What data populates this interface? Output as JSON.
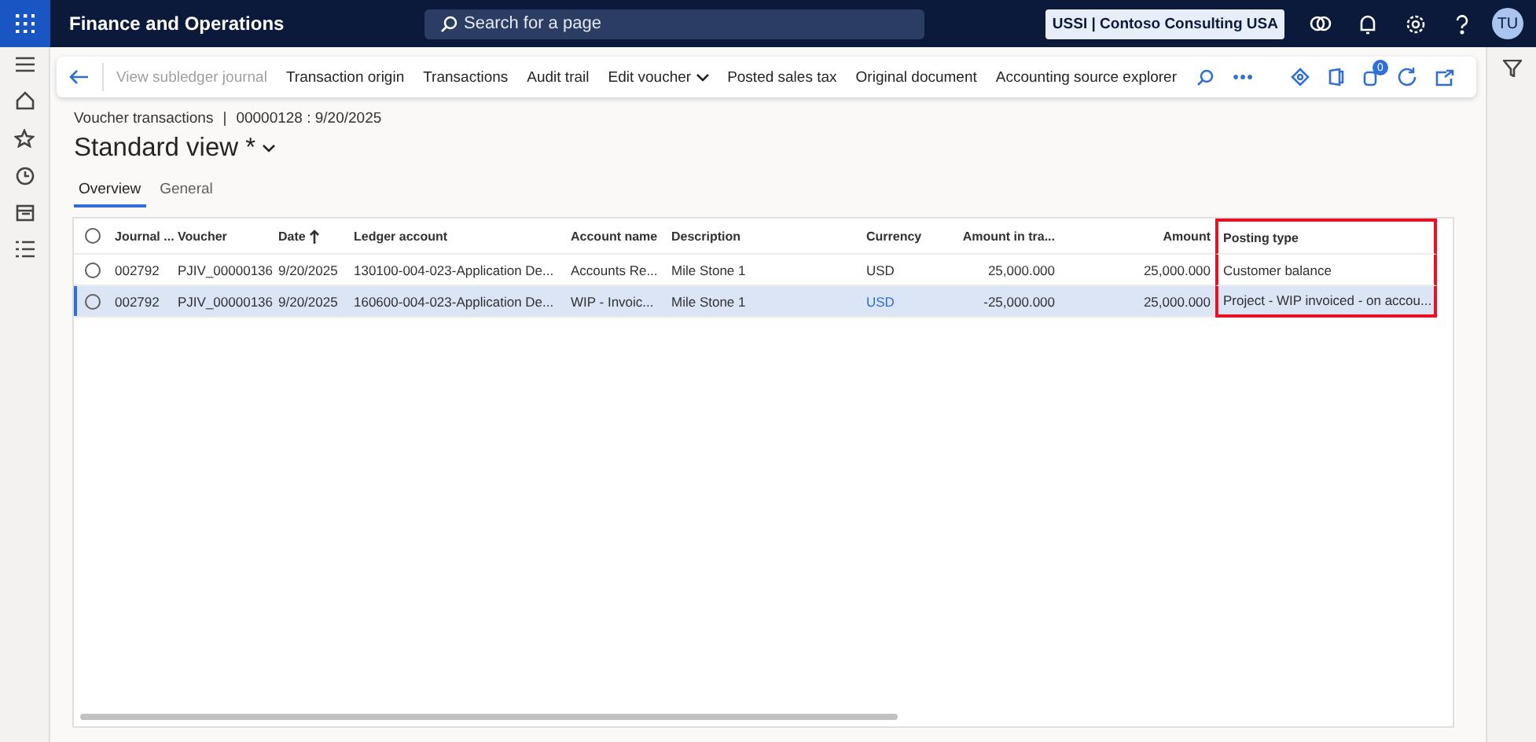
{
  "app_bar": {
    "title": "Finance and Operations",
    "search": {
      "placeholder": "Search for a page"
    },
    "company": "USSI | Contoso Consulting USA",
    "avatar": "TU"
  },
  "action_pane": {
    "items": [
      {
        "label": "View subledger journal",
        "disabled": true,
        "dropdown": false
      },
      {
        "label": "Transaction origin",
        "disabled": false,
        "dropdown": false
      },
      {
        "label": "Transactions",
        "disabled": false,
        "dropdown": false
      },
      {
        "label": "Audit trail",
        "disabled": false,
        "dropdown": false
      },
      {
        "label": "Edit voucher",
        "disabled": false,
        "dropdown": true
      },
      {
        "label": "Posted sales tax",
        "disabled": false,
        "dropdown": false
      },
      {
        "label": "Original document",
        "disabled": false,
        "dropdown": false
      },
      {
        "label": "Accounting source explorer",
        "disabled": false,
        "dropdown": false
      }
    ],
    "attachments_count": "0"
  },
  "breadcrumb": {
    "page": "Voucher transactions",
    "separator": "|",
    "record": "00000128 : 9/20/2025"
  },
  "view_title": "Standard view *",
  "tabs": [
    {
      "label": "Overview",
      "selected": true
    },
    {
      "label": "General",
      "selected": false
    }
  ],
  "grid": {
    "columns": [
      {
        "label": "Journal ...",
        "sorted": false,
        "highlighted": false
      },
      {
        "label": "Voucher",
        "sorted": false,
        "highlighted": false
      },
      {
        "label": "Date",
        "sorted": true,
        "highlighted": false
      },
      {
        "label": "Ledger account",
        "sorted": false,
        "highlighted": false
      },
      {
        "label": "Account name",
        "sorted": false,
        "highlighted": false
      },
      {
        "label": "Description",
        "sorted": false,
        "highlighted": false
      },
      {
        "label": "Currency",
        "sorted": false,
        "highlighted": false
      },
      {
        "label": "Amount in tra...",
        "sorted": false,
        "highlighted": false
      },
      {
        "label": "Amount",
        "sorted": false,
        "highlighted": false
      },
      {
        "label": "Posting type",
        "sorted": false,
        "highlighted": true
      }
    ],
    "all_selected": false,
    "rows": [
      {
        "selected": false,
        "cells": [
          "002792",
          "PJIV_00000136",
          "9/20/2025",
          "130100-004-023-Application De...",
          "Accounts Re...",
          "Mile Stone 1",
          "USD",
          "25,000.000",
          "25,000.000",
          "Customer balance"
        ]
      },
      {
        "selected": true,
        "cells": [
          "002792",
          "PJIV_00000136",
          "9/20/2025",
          "160600-004-023-Application De...",
          "WIP - Invoic...",
          "Mile Stone 1",
          "USD",
          "-25,000.000",
          "25,000.000",
          "Project - WIP invoiced - on accou..."
        ]
      }
    ]
  }
}
